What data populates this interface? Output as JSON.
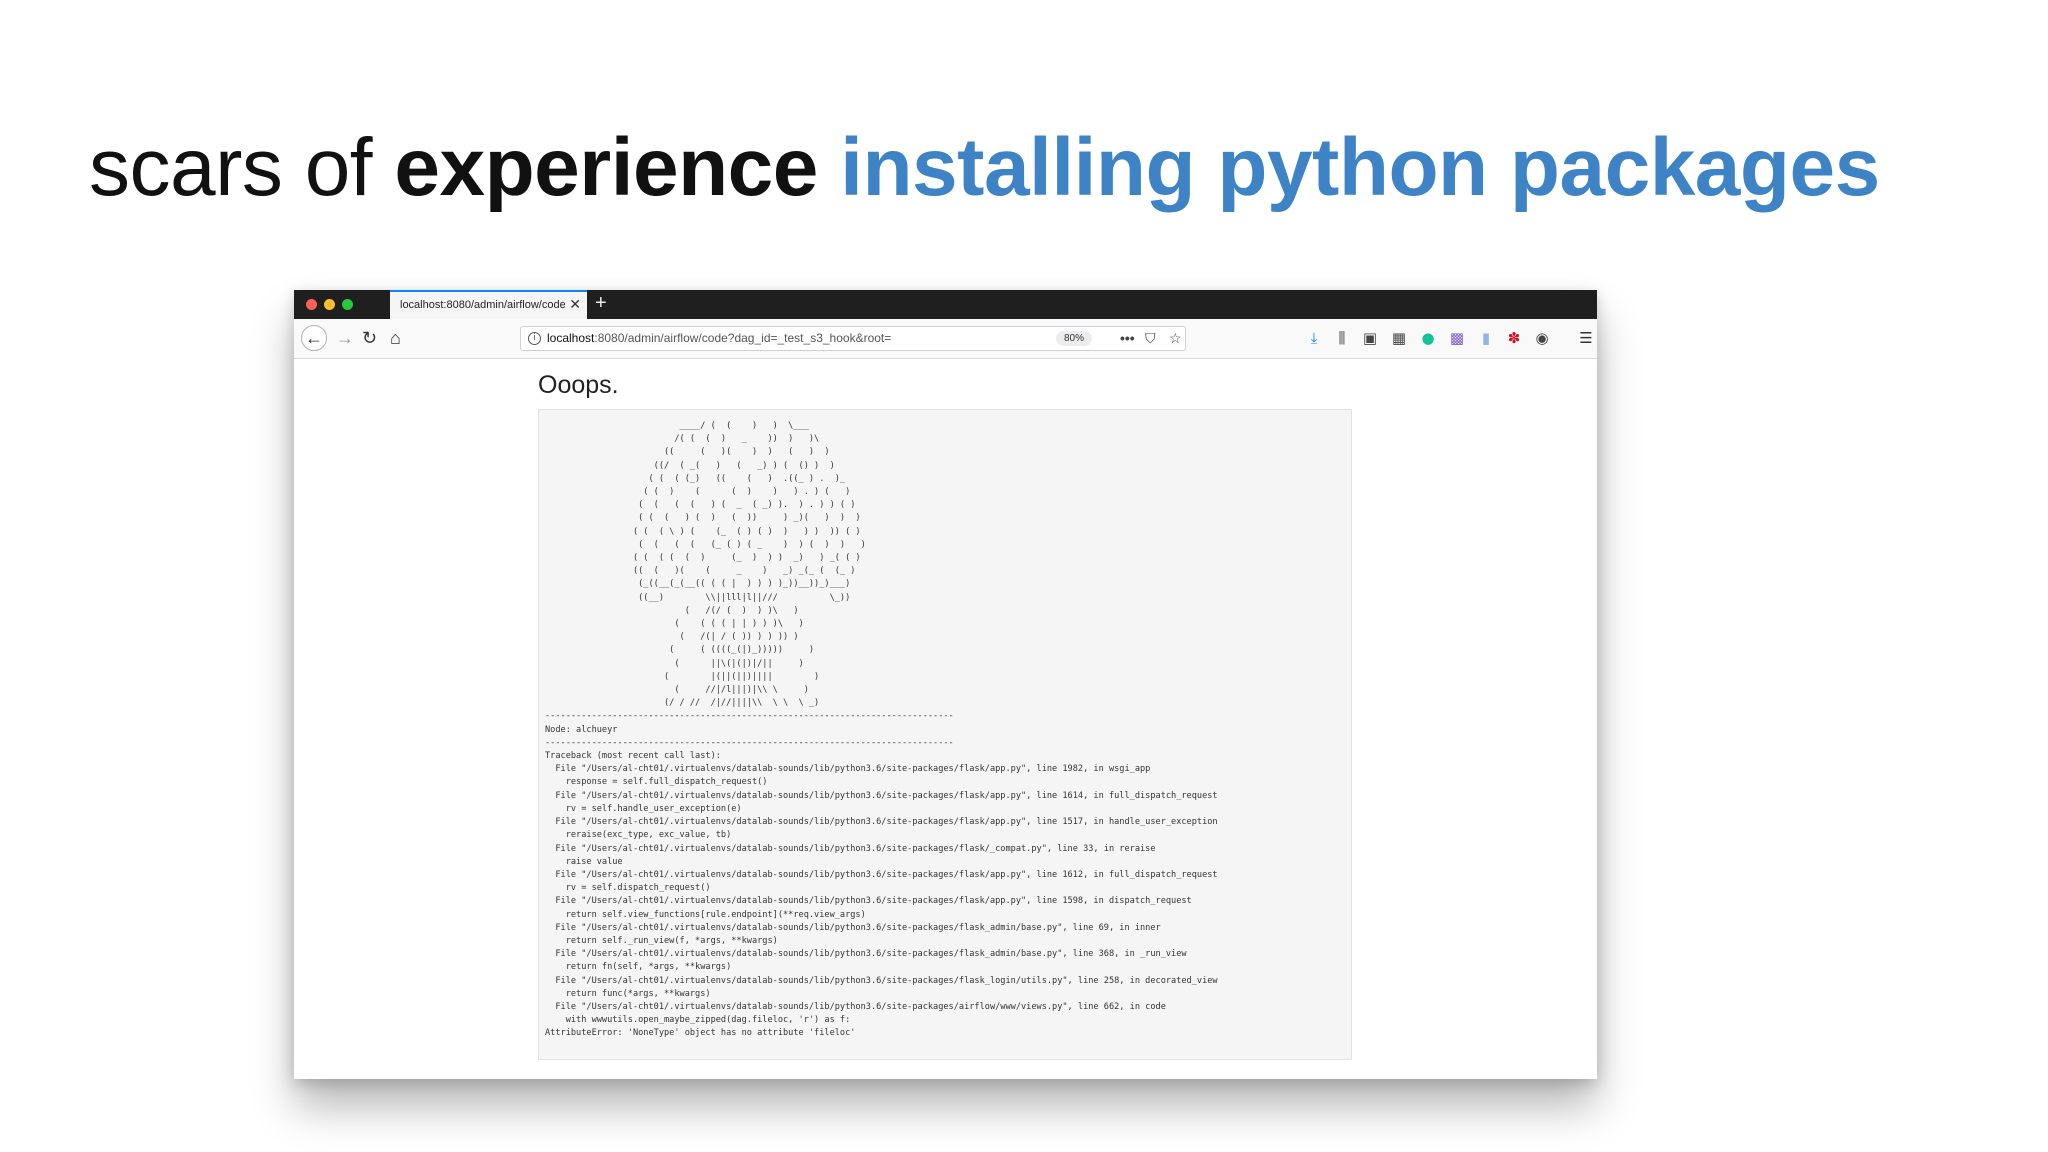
{
  "slide": {
    "title_part1": "scars of ",
    "title_part2": "experience",
    "title_part3": " installing python packages",
    "title_color": "#111111",
    "accent_color": "#3d83c6"
  },
  "browser": {
    "traffic_lights": {
      "close": "#ff5f57",
      "minimize": "#febc2e",
      "maximize": "#28c840"
    },
    "tab_title": "localhost:8080/admin/airflow/code?",
    "tab_close_glyph": "✕",
    "new_tab_glyph": "+",
    "url_host": "localhost",
    "url_rest": ":8080/admin/airflow/code?dag_id=_test_s3_hook&root=",
    "zoom": "80%",
    "toolbar_icons": [
      {
        "name": "download-icon",
        "glyph": "⤓",
        "color": "#0a84ff"
      },
      {
        "name": "library-icon",
        "glyph": "⫼",
        "color": "#444444"
      },
      {
        "name": "sidebar-icon",
        "glyph": "▣",
        "color": "#444444"
      },
      {
        "name": "extension-grid-icon",
        "glyph": "▦",
        "color": "#444444"
      },
      {
        "name": "grammarly-icon",
        "glyph": "●",
        "color": "#15c39a"
      },
      {
        "name": "extension-purple-icon",
        "glyph": "▩",
        "color": "#7b5cc9"
      },
      {
        "name": "extension-blue-icon",
        "glyph": "▮",
        "color": "#8fb6e8"
      },
      {
        "name": "extension-red-icon",
        "glyph": "✽",
        "color": "#d0121b"
      },
      {
        "name": "account-icon",
        "glyph": "◉",
        "color": "#444444"
      },
      {
        "name": "menu-icon",
        "glyph": "☰",
        "color": "#333333"
      }
    ]
  },
  "page": {
    "heading": "Ooops.",
    "error_text": "                          ____/ (  (    )   )  \\___\n                         /( (  (  )   _    ))  )   )\\\n                       ((     (   )(    )  )   (   )  )\n                     ((/  ( _(   )   (   _) ) (  () )  )\n                    ( (  ( (_)   ((    (   )  .((_ ) .  )_\n                   ( (  )    (      (  )    )   ) . ) (   )\n                  (  (   (  (   ) (  _  ( _) ).  ) . ) ) ( )\n                  ( (  (   ) (  )   (  ))     ) _)(   )  )  )\n                 ( (  ( \\ ) (    (_  ( ) ( )  )   ) )  )) ( )\n                  (  (   (  (   (_ ( ) ( _    )  ) (  )  )   )\n                 ( (  ( (  (  )     (_  )  ) )  _)   ) _( ( )\n                 ((  (   )(    (     _    )   _) _(_ (  (_ )\n                  (_((__(_(__(( ( ( |  ) ) ) )_))__))_)___)\n                  ((__)        \\\\||lll|l||///          \\_))\n                           (   /(/ (  )  ) )\\   )\n                         (    ( ( ( | | ) ) )\\   )\n                          (   /(| / ( )) ) ) )) )\n                        (     ( ((((_(|)_)))))     )\n                         (      ||\\(|(|)|/||     )\n                       (        |(||(||)||||        )\n                         (     //|/l|||)|\\\\ \\     )\n                       (/ / //  /|//||||\\\\  \\ \\  \\ _)\n-------------------------------------------------------------------------------\nNode: alchueyr\n-------------------------------------------------------------------------------\nTraceback (most recent call last):\n  File \"/Users/al-cht01/.virtualenvs/datalab-sounds/lib/python3.6/site-packages/flask/app.py\", line 1982, in wsgi_app\n    response = self.full_dispatch_request()\n  File \"/Users/al-cht01/.virtualenvs/datalab-sounds/lib/python3.6/site-packages/flask/app.py\", line 1614, in full_dispatch_request\n    rv = self.handle_user_exception(e)\n  File \"/Users/al-cht01/.virtualenvs/datalab-sounds/lib/python3.6/site-packages/flask/app.py\", line 1517, in handle_user_exception\n    reraise(exc_type, exc_value, tb)\n  File \"/Users/al-cht01/.virtualenvs/datalab-sounds/lib/python3.6/site-packages/flask/_compat.py\", line 33, in reraise\n    raise value\n  File \"/Users/al-cht01/.virtualenvs/datalab-sounds/lib/python3.6/site-packages/flask/app.py\", line 1612, in full_dispatch_request\n    rv = self.dispatch_request()\n  File \"/Users/al-cht01/.virtualenvs/datalab-sounds/lib/python3.6/site-packages/flask/app.py\", line 1598, in dispatch_request\n    return self.view_functions[rule.endpoint](**req.view_args)\n  File \"/Users/al-cht01/.virtualenvs/datalab-sounds/lib/python3.6/site-packages/flask_admin/base.py\", line 69, in inner\n    return self._run_view(f, *args, **kwargs)\n  File \"/Users/al-cht01/.virtualenvs/datalab-sounds/lib/python3.6/site-packages/flask_admin/base.py\", line 368, in _run_view\n    return fn(self, *args, **kwargs)\n  File \"/Users/al-cht01/.virtualenvs/datalab-sounds/lib/python3.6/site-packages/flask_login/utils.py\", line 258, in decorated_view\n    return func(*args, **kwargs)\n  File \"/Users/al-cht01/.virtualenvs/datalab-sounds/lib/python3.6/site-packages/airflow/www/views.py\", line 662, in code\n    with wwwutils.open_maybe_zipped(dag.fileloc, 'r') as f:\nAttributeError: 'NoneType' object has no attribute 'fileloc'"
  }
}
